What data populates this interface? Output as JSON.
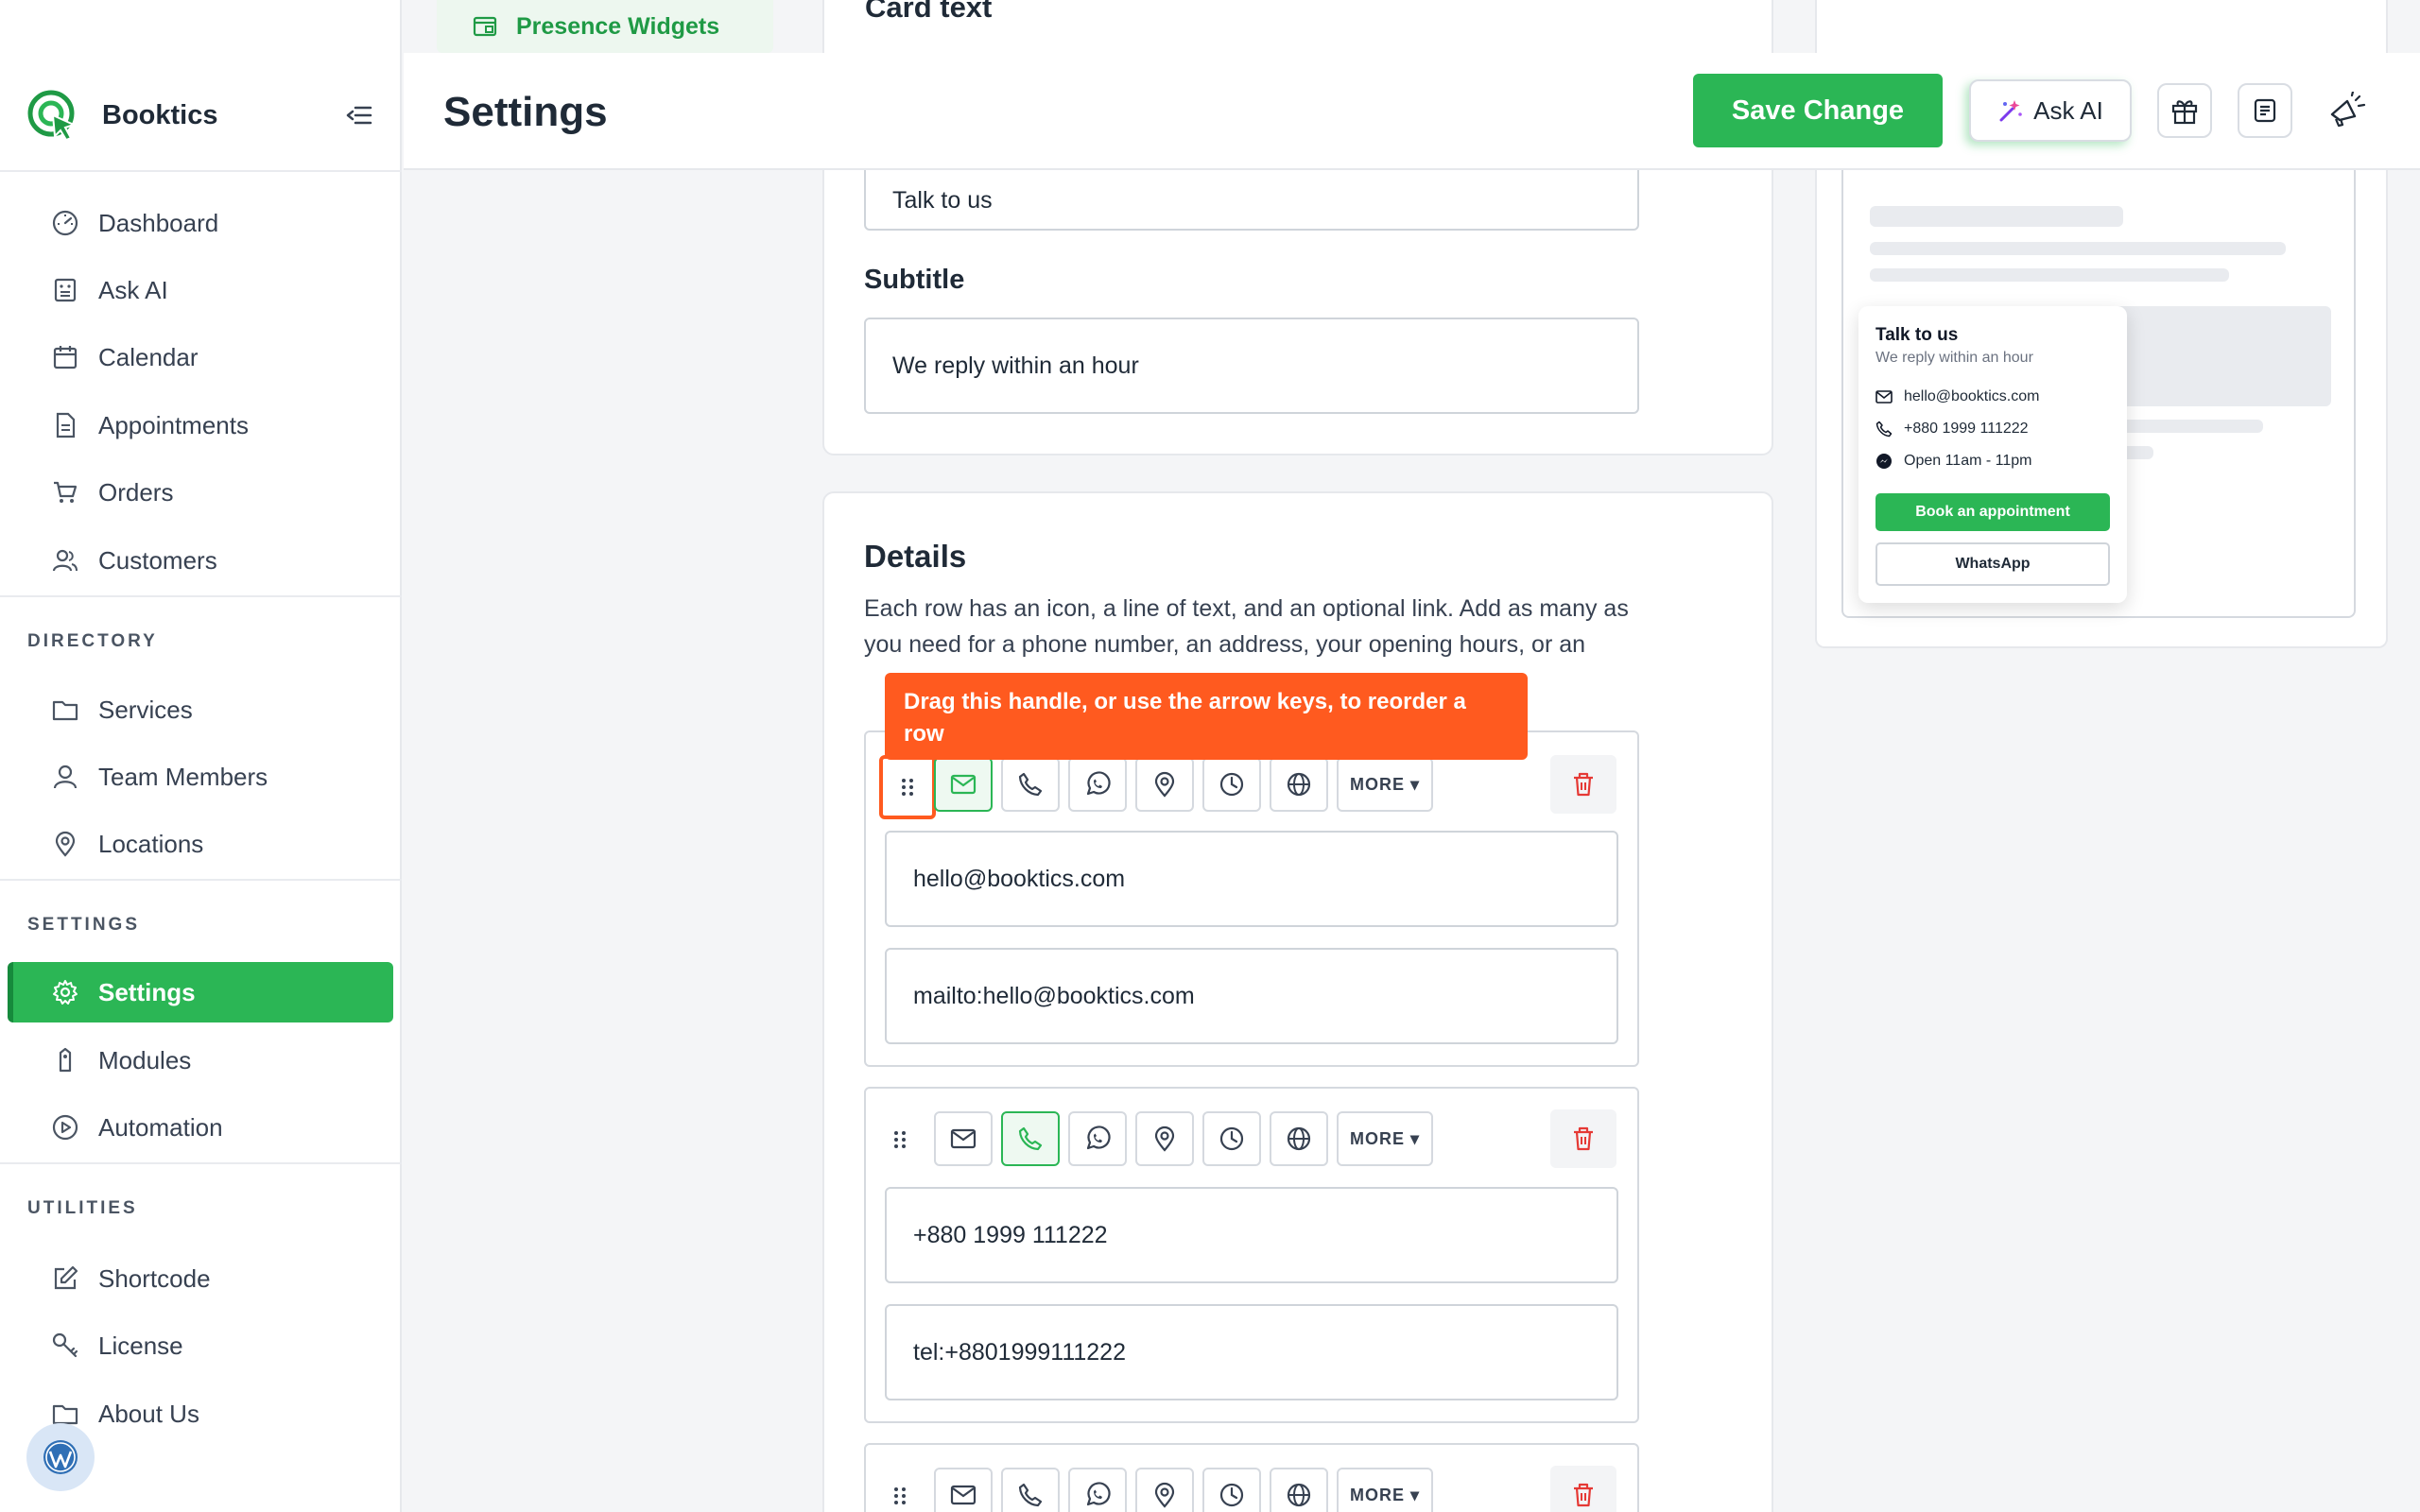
{
  "app": {
    "name": "Booktics",
    "page_title": "Settings"
  },
  "sidebar": {
    "sections": {
      "directory": "DIRECTORY",
      "settings": "SETTINGS",
      "utilities": "UTILITIES"
    },
    "items": [
      {
        "label": "Dashboard",
        "icon": "gauge-icon"
      },
      {
        "label": "Ask AI",
        "icon": "robot-icon"
      },
      {
        "label": "Calendar",
        "icon": "calendar-icon"
      },
      {
        "label": "Appointments",
        "icon": "document-icon"
      },
      {
        "label": "Orders",
        "icon": "cart-icon"
      },
      {
        "label": "Customers",
        "icon": "users-icon"
      },
      {
        "label": "Services",
        "icon": "folder-icon"
      },
      {
        "label": "Team Members",
        "icon": "user-icon"
      },
      {
        "label": "Locations",
        "icon": "map-pin-icon"
      },
      {
        "label": "Settings",
        "icon": "gear-icon",
        "active": true
      },
      {
        "label": "Modules",
        "icon": "tag-icon"
      },
      {
        "label": "Automation",
        "icon": "play-circle-icon"
      },
      {
        "label": "Shortcode",
        "icon": "edit-icon"
      },
      {
        "label": "License",
        "icon": "key-icon"
      },
      {
        "label": "About Us",
        "icon": "folder-icon"
      }
    ]
  },
  "header": {
    "save_label": "Save Change",
    "ask_ai_label": "Ask AI"
  },
  "tab": {
    "label": "Presence Widgets"
  },
  "card_text": {
    "heading": "Card text",
    "title_value": "Talk to us",
    "subtitle_label": "Subtitle",
    "subtitle_value": "We reply within an hour"
  },
  "details": {
    "heading": "Details",
    "description": "Each row has an icon, a line of text, and an optional link. Add as many as you need for a phone number, an address, your opening hours, or an",
    "more_label": "MORE ▾",
    "rows": [
      {
        "text": "hello@booktics.com",
        "link": "mailto:hello@booktics.com",
        "active_icon": "email"
      },
      {
        "text": "+880 1999 111222",
        "link": "tel:+8801999111222",
        "active_icon": "phone"
      },
      {
        "text": "",
        "link": "",
        "active_icon": "none"
      }
    ]
  },
  "tooltip": {
    "text": "Drag this handle, or use the arrow keys, to reorder a row"
  },
  "preview": {
    "title": "Talk to us",
    "subtitle": "We reply within an hour",
    "email": "hello@booktics.com",
    "phone": "+880 1999 111222",
    "hours": "Open 11am - 11pm",
    "primary_button": "Book an appointment",
    "secondary_button": "WhatsApp"
  },
  "colors": {
    "brand_green": "#2bb655",
    "tooltip_orange": "#ff5a1f",
    "danger_red": "#e53935"
  }
}
